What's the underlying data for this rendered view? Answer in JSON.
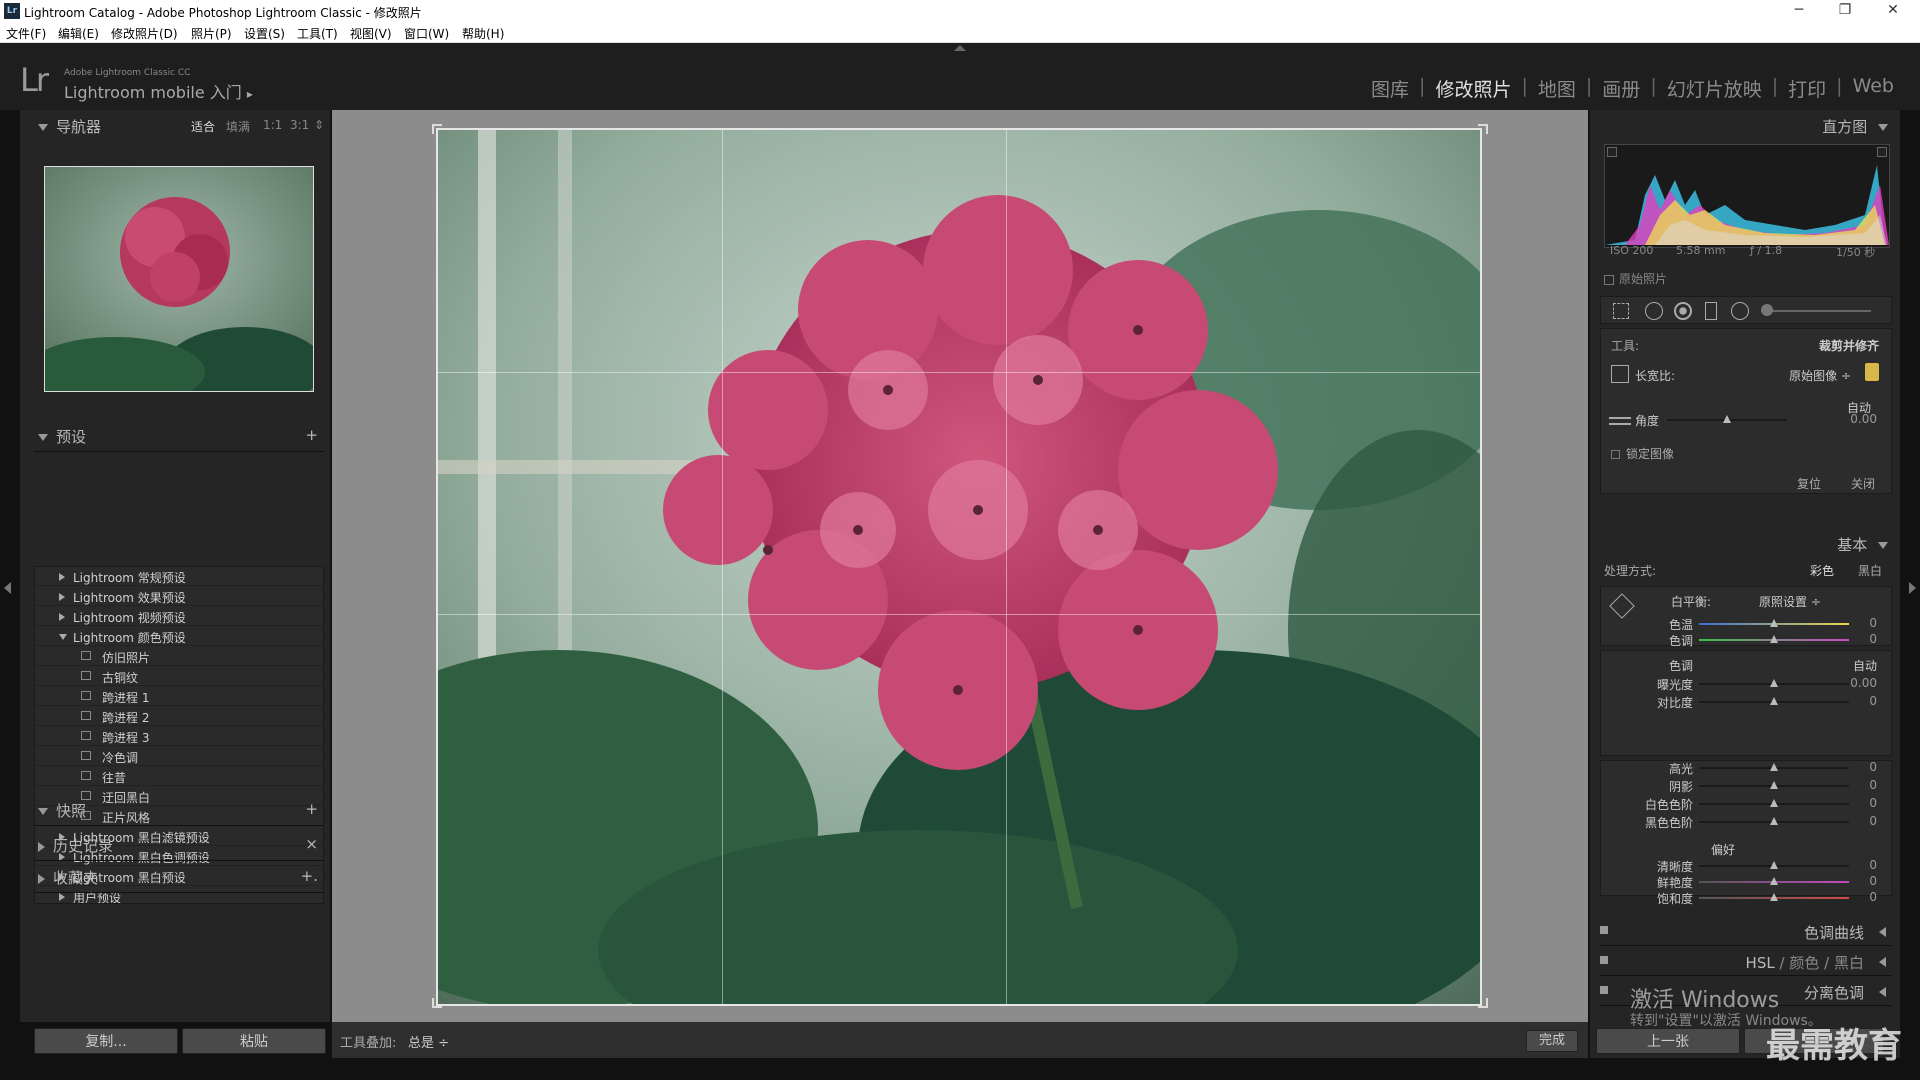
{
  "window": {
    "title": "Lightroom Catalog - Adobe Photoshop Lightroom Classic - 修改照片",
    "minimize": "─",
    "restore": "❐",
    "close": "✕"
  },
  "menu": [
    "文件(F)",
    "编辑(E)",
    "修改照片(D)",
    "照片(P)",
    "设置(S)",
    "工具(T)",
    "视图(V)",
    "窗口(W)",
    "帮助(H)"
  ],
  "brand": {
    "logo": "Lr",
    "sub": "Adobe Lightroom Classic CC",
    "mobile": "Lightroom mobile 入门",
    "mobile_arrow": "▸"
  },
  "modules": [
    {
      "label": "图库",
      "active": false
    },
    {
      "label": "修改照片",
      "active": true
    },
    {
      "label": "地图",
      "active": false
    },
    {
      "label": "画册",
      "active": false
    },
    {
      "label": "幻灯片放映",
      "active": false
    },
    {
      "label": "打印",
      "active": false
    },
    {
      "label": "Web",
      "active": false
    }
  ],
  "navigator": {
    "title": "导航器",
    "zoom": [
      "适合",
      "填满",
      "1:1",
      "3:1"
    ],
    "zoom_active": "适合",
    "zoom_stepper": "⇕"
  },
  "presets": {
    "title": "预设",
    "add": "+",
    "items": [
      {
        "label": "Lightroom 常规预设",
        "level": 0,
        "open": false
      },
      {
        "label": "Lightroom 效果预设",
        "level": 0,
        "open": false
      },
      {
        "label": "Lightroom 视频预设",
        "level": 0,
        "open": false
      },
      {
        "label": "Lightroom 颜色预设",
        "level": 0,
        "open": true
      },
      {
        "label": "仿旧照片",
        "level": 1
      },
      {
        "label": "古铜纹",
        "level": 1
      },
      {
        "label": "跨进程 1",
        "level": 1
      },
      {
        "label": "跨进程 2",
        "level": 1
      },
      {
        "label": "跨进程 3",
        "level": 1
      },
      {
        "label": "冷色调",
        "level": 1
      },
      {
        "label": "往昔",
        "level": 1
      },
      {
        "label": "迂回黑白",
        "level": 1
      },
      {
        "label": "正片风格",
        "level": 1
      },
      {
        "label": "Lightroom 黑白滤镜预设",
        "level": 0,
        "open": false
      },
      {
        "label": "Lightroom 黑白色调预设",
        "level": 0,
        "open": false
      },
      {
        "label": "Lightroom 黑白预设",
        "level": 0,
        "open": false
      },
      {
        "label": "用户预设",
        "level": 0,
        "open": false
      }
    ]
  },
  "snapshots": {
    "title": "快照",
    "add": "+"
  },
  "history": {
    "title": "历史记录",
    "clear": "×"
  },
  "collections": {
    "title": "收藏夹",
    "add": "+."
  },
  "left_buttons": {
    "copy": "复制...",
    "paste": "粘贴"
  },
  "toolbar": {
    "overlay_label": "工具叠加:",
    "overlay_value": "总是 ÷",
    "done": "完成"
  },
  "histogram": {
    "title": "直方图",
    "iso": "ISO 200",
    "focal": "5.58 mm",
    "aperture": "ƒ / 1.8",
    "shutter": "1/50 秒",
    "original_label": "原始照片"
  },
  "crop": {
    "tool_label": "工具:",
    "tool_name": "裁剪并修齐",
    "aspect_label": "长宽比:",
    "aspect_value": "原始图像 ÷",
    "auto": "自动",
    "angle_label": "角度",
    "angle_value": "0.00",
    "angle_pos": 0.5,
    "constrain_label": "锁定图像",
    "reset": "复位",
    "close": "关闭"
  },
  "basic": {
    "title": "基本",
    "treatment_label": "处理方式:",
    "color": "彩色",
    "bw": "黑白",
    "wb_label": "白平衡:",
    "wb_value": "原照设置 ÷",
    "wb_sliders": [
      {
        "label": "色温",
        "value": "0",
        "pos": 0.5
      },
      {
        "label": "色调",
        "value": "0",
        "pos": 0.5
      }
    ],
    "tone_label": "色调",
    "tone_auto": "自动",
    "tone_sliders": [
      {
        "label": "曝光度",
        "value": "0.00",
        "pos": 0.5
      },
      {
        "label": "对比度",
        "value": "0",
        "pos": 0.5
      }
    ],
    "tone_sliders2": [
      {
        "label": "高光",
        "value": "0",
        "pos": 0.5
      },
      {
        "label": "阴影",
        "value": "0",
        "pos": 0.5
      },
      {
        "label": "白色色阶",
        "value": "0",
        "pos": 0.5
      },
      {
        "label": "黑色色阶",
        "value": "0",
        "pos": 0.5
      }
    ],
    "presence_label": "偏好",
    "presence_sliders": [
      {
        "label": "清晰度",
        "value": "0",
        "pos": 0.5
      },
      {
        "label": "鲜艳度",
        "value": "0",
        "pos": 0.5
      },
      {
        "label": "饱和度",
        "value": "0",
        "pos": 0.5
      }
    ]
  },
  "collapsed_panels": {
    "tone_curve": "色调曲线",
    "hsl": "HSL",
    "hsl_sep": "/",
    "hsl_color": "颜色",
    "hsl_bw": "黑白",
    "split_toning": "分离色调"
  },
  "right_buttons": {
    "prev": "上一张"
  },
  "watermark": {
    "line1": "激活 Windows",
    "line2": "转到\"设置\"以激活 Windows。",
    "brand": "最需教育"
  },
  "colors": {
    "accent": "#e6e6e6",
    "panel": "#252525",
    "background": "#111111"
  }
}
